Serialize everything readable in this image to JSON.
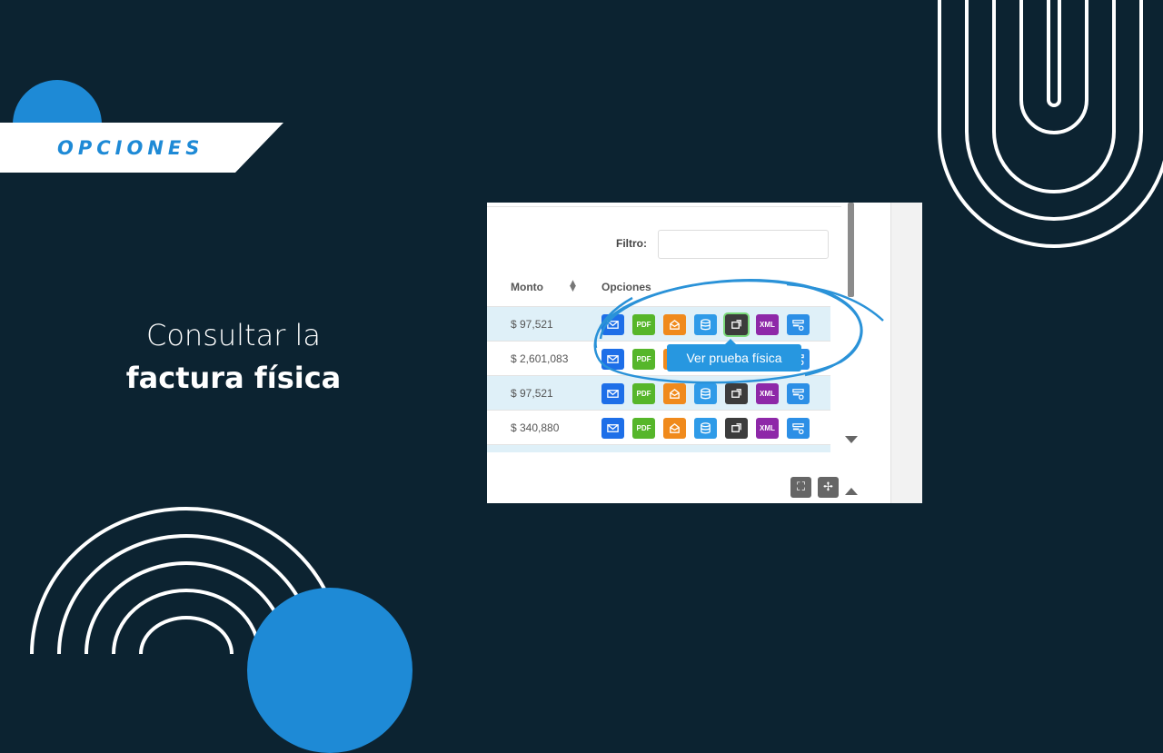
{
  "section_label": "OPCIONES",
  "heading": {
    "line1": "Consultar la",
    "line2": "factura física"
  },
  "screenshot": {
    "filter_label": "Filtro:",
    "filter_value": "",
    "columns": {
      "monto": "Monto",
      "opciones": "Opciones"
    },
    "rows": [
      {
        "monto": "$ 97,521"
      },
      {
        "monto": "$ 2,601,083"
      },
      {
        "monto": "$ 97,521"
      },
      {
        "monto": "$ 340,880"
      }
    ],
    "tooltip": "Ver prueba física",
    "icon_labels": {
      "pdf": "PDF",
      "xml": "XML"
    }
  },
  "colors": {
    "background": "#0c2331",
    "accent_blue": "#1e8ad6",
    "email_btn": "#1e6fe8",
    "pdf_btn": "#56b62a",
    "envelope_btn": "#f08a1c",
    "database_btn": "#2f9be8",
    "physical_btn": "#3c3c3c",
    "xml_btn": "#8e28a8",
    "config_btn": "#2c8fe6"
  }
}
